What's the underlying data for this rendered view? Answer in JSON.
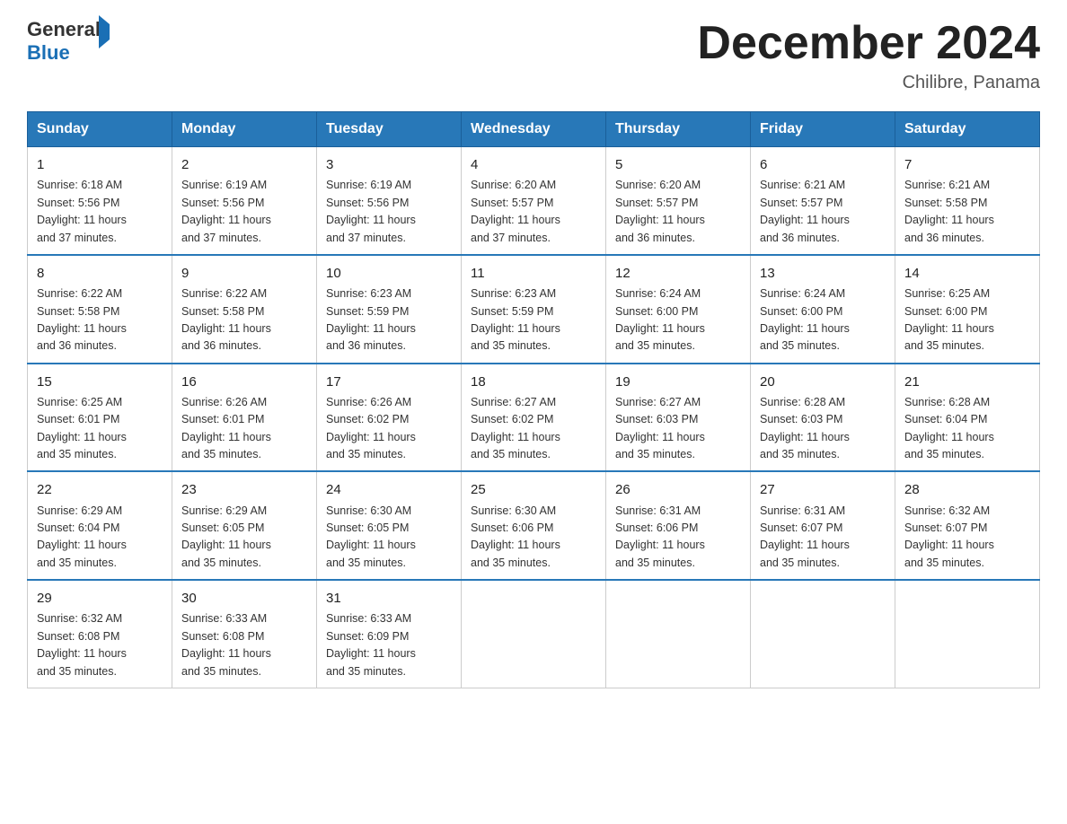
{
  "header": {
    "logo": {
      "text_general": "General",
      "text_blue": "Blue"
    },
    "title": "December 2024",
    "location": "Chilibre, Panama"
  },
  "calendar": {
    "days_of_week": [
      "Sunday",
      "Monday",
      "Tuesday",
      "Wednesday",
      "Thursday",
      "Friday",
      "Saturday"
    ],
    "weeks": [
      [
        {
          "day": "1",
          "sunrise": "6:18 AM",
          "sunset": "5:56 PM",
          "daylight": "11 hours and 37 minutes."
        },
        {
          "day": "2",
          "sunrise": "6:19 AM",
          "sunset": "5:56 PM",
          "daylight": "11 hours and 37 minutes."
        },
        {
          "day": "3",
          "sunrise": "6:19 AM",
          "sunset": "5:56 PM",
          "daylight": "11 hours and 37 minutes."
        },
        {
          "day": "4",
          "sunrise": "6:20 AM",
          "sunset": "5:57 PM",
          "daylight": "11 hours and 37 minutes."
        },
        {
          "day": "5",
          "sunrise": "6:20 AM",
          "sunset": "5:57 PM",
          "daylight": "11 hours and 36 minutes."
        },
        {
          "day": "6",
          "sunrise": "6:21 AM",
          "sunset": "5:57 PM",
          "daylight": "11 hours and 36 minutes."
        },
        {
          "day": "7",
          "sunrise": "6:21 AM",
          "sunset": "5:58 PM",
          "daylight": "11 hours and 36 minutes."
        }
      ],
      [
        {
          "day": "8",
          "sunrise": "6:22 AM",
          "sunset": "5:58 PM",
          "daylight": "11 hours and 36 minutes."
        },
        {
          "day": "9",
          "sunrise": "6:22 AM",
          "sunset": "5:58 PM",
          "daylight": "11 hours and 36 minutes."
        },
        {
          "day": "10",
          "sunrise": "6:23 AM",
          "sunset": "5:59 PM",
          "daylight": "11 hours and 36 minutes."
        },
        {
          "day": "11",
          "sunrise": "6:23 AM",
          "sunset": "5:59 PM",
          "daylight": "11 hours and 35 minutes."
        },
        {
          "day": "12",
          "sunrise": "6:24 AM",
          "sunset": "6:00 PM",
          "daylight": "11 hours and 35 minutes."
        },
        {
          "day": "13",
          "sunrise": "6:24 AM",
          "sunset": "6:00 PM",
          "daylight": "11 hours and 35 minutes."
        },
        {
          "day": "14",
          "sunrise": "6:25 AM",
          "sunset": "6:00 PM",
          "daylight": "11 hours and 35 minutes."
        }
      ],
      [
        {
          "day": "15",
          "sunrise": "6:25 AM",
          "sunset": "6:01 PM",
          "daylight": "11 hours and 35 minutes."
        },
        {
          "day": "16",
          "sunrise": "6:26 AM",
          "sunset": "6:01 PM",
          "daylight": "11 hours and 35 minutes."
        },
        {
          "day": "17",
          "sunrise": "6:26 AM",
          "sunset": "6:02 PM",
          "daylight": "11 hours and 35 minutes."
        },
        {
          "day": "18",
          "sunrise": "6:27 AM",
          "sunset": "6:02 PM",
          "daylight": "11 hours and 35 minutes."
        },
        {
          "day": "19",
          "sunrise": "6:27 AM",
          "sunset": "6:03 PM",
          "daylight": "11 hours and 35 minutes."
        },
        {
          "day": "20",
          "sunrise": "6:28 AM",
          "sunset": "6:03 PM",
          "daylight": "11 hours and 35 minutes."
        },
        {
          "day": "21",
          "sunrise": "6:28 AM",
          "sunset": "6:04 PM",
          "daylight": "11 hours and 35 minutes."
        }
      ],
      [
        {
          "day": "22",
          "sunrise": "6:29 AM",
          "sunset": "6:04 PM",
          "daylight": "11 hours and 35 minutes."
        },
        {
          "day": "23",
          "sunrise": "6:29 AM",
          "sunset": "6:05 PM",
          "daylight": "11 hours and 35 minutes."
        },
        {
          "day": "24",
          "sunrise": "6:30 AM",
          "sunset": "6:05 PM",
          "daylight": "11 hours and 35 minutes."
        },
        {
          "day": "25",
          "sunrise": "6:30 AM",
          "sunset": "6:06 PM",
          "daylight": "11 hours and 35 minutes."
        },
        {
          "day": "26",
          "sunrise": "6:31 AM",
          "sunset": "6:06 PM",
          "daylight": "11 hours and 35 minutes."
        },
        {
          "day": "27",
          "sunrise": "6:31 AM",
          "sunset": "6:07 PM",
          "daylight": "11 hours and 35 minutes."
        },
        {
          "day": "28",
          "sunrise": "6:32 AM",
          "sunset": "6:07 PM",
          "daylight": "11 hours and 35 minutes."
        }
      ],
      [
        {
          "day": "29",
          "sunrise": "6:32 AM",
          "sunset": "6:08 PM",
          "daylight": "11 hours and 35 minutes."
        },
        {
          "day": "30",
          "sunrise": "6:33 AM",
          "sunset": "6:08 PM",
          "daylight": "11 hours and 35 minutes."
        },
        {
          "day": "31",
          "sunrise": "6:33 AM",
          "sunset": "6:09 PM",
          "daylight": "11 hours and 35 minutes."
        },
        null,
        null,
        null,
        null
      ]
    ],
    "labels": {
      "sunrise": "Sunrise:",
      "sunset": "Sunset:",
      "daylight": "Daylight:"
    }
  }
}
